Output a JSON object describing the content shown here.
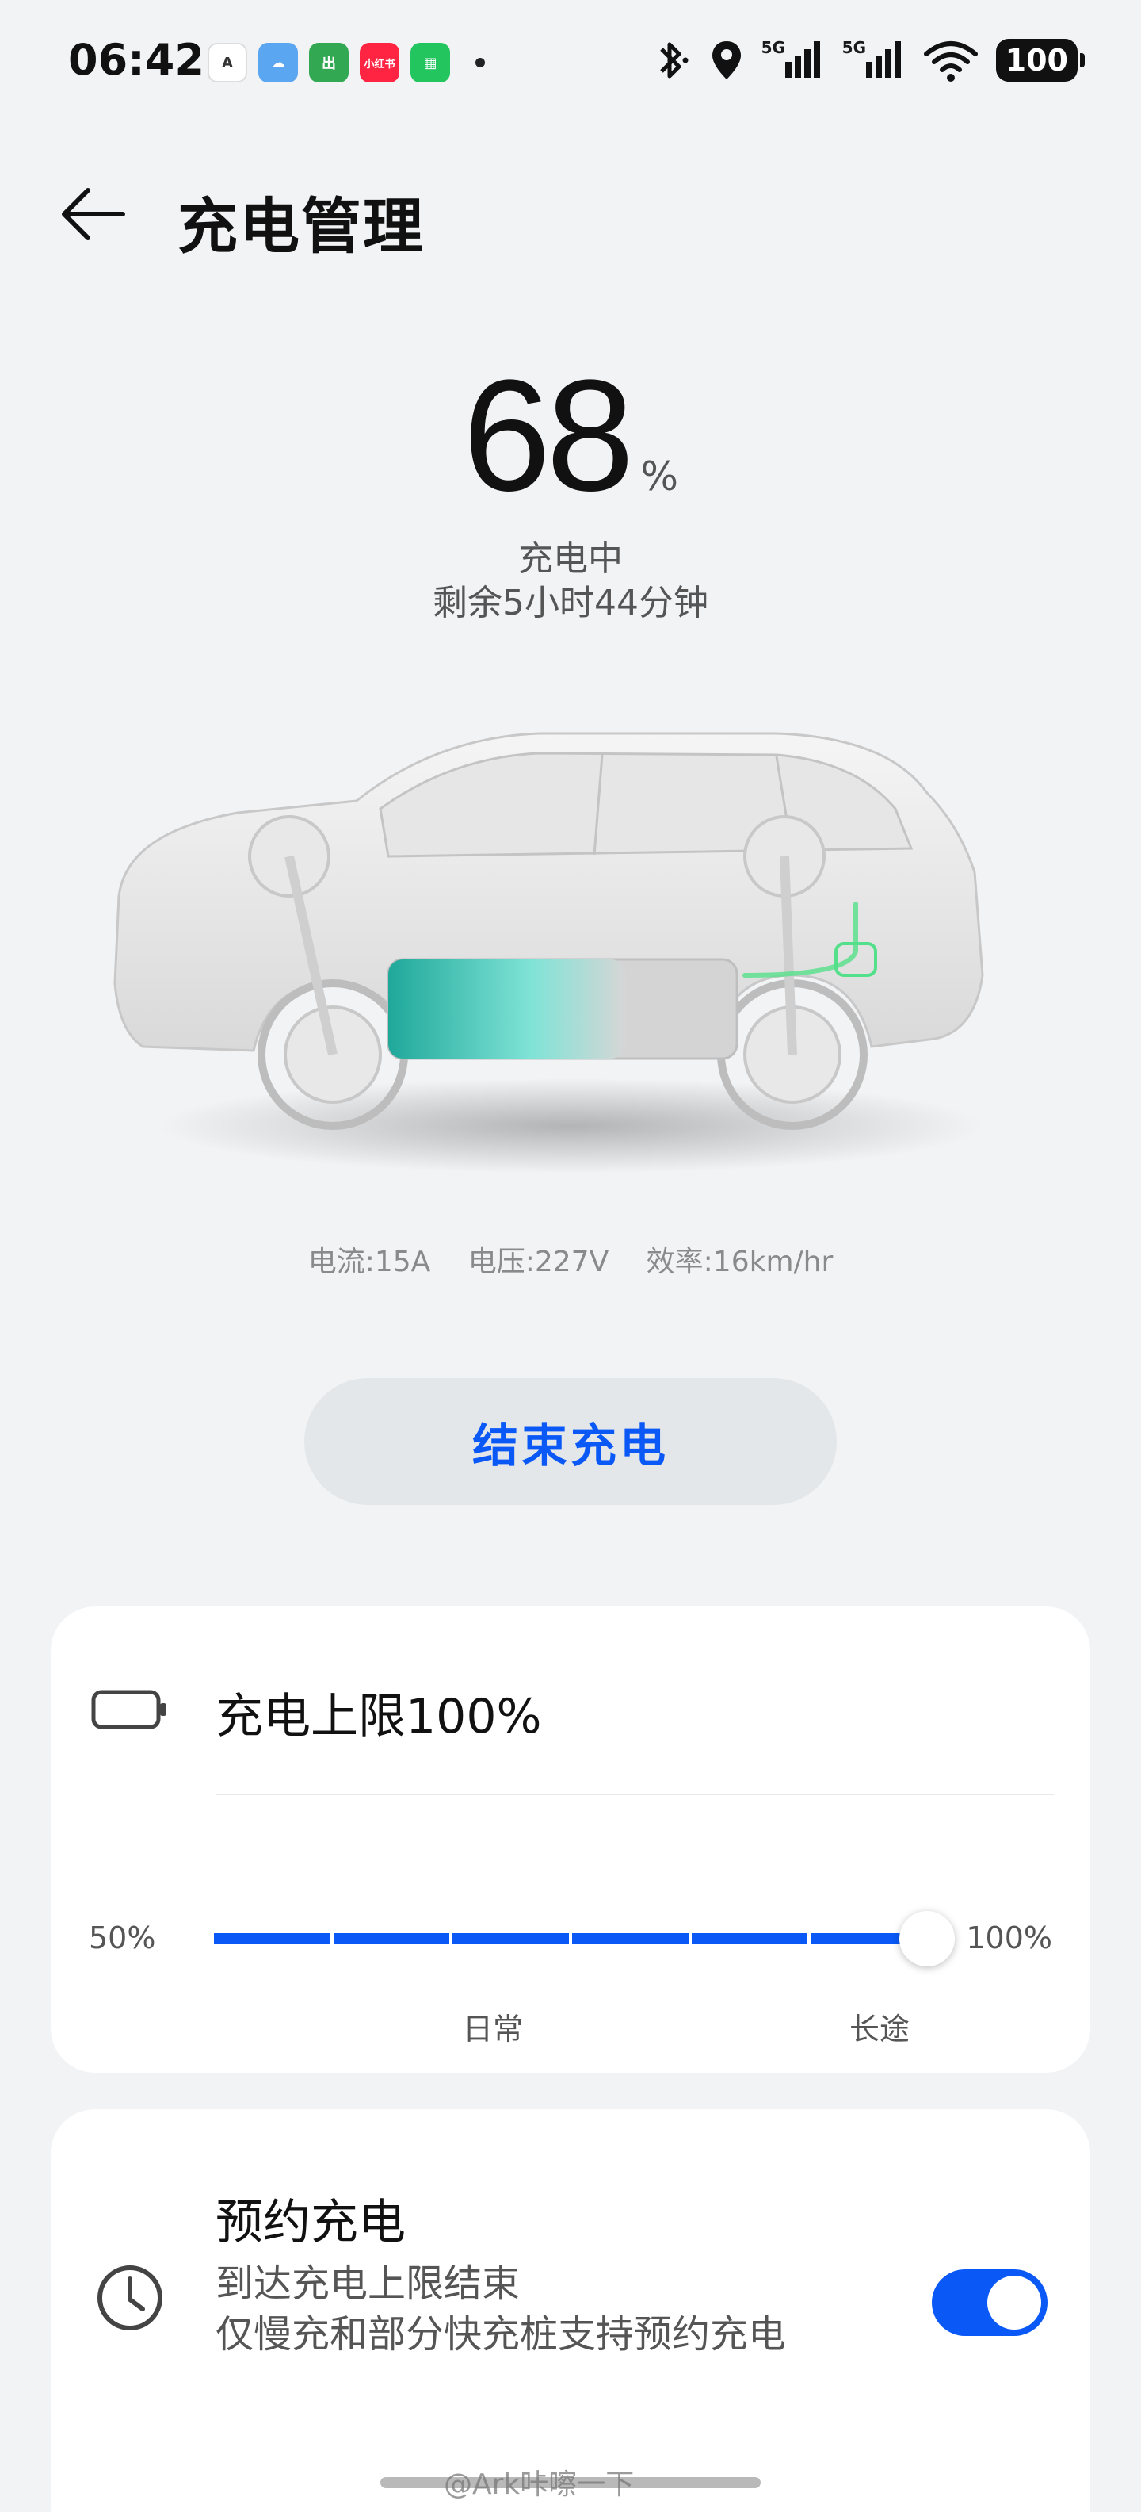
{
  "status_bar": {
    "time": "06:42",
    "app_icons": [
      {
        "name": "app-icon-1",
        "label": "A",
        "color": "#ffffff",
        "text_color": "#333333"
      },
      {
        "name": "weather-icon",
        "label": "☁",
        "color": "#5aa6f0",
        "text_color": "#ffffff"
      },
      {
        "name": "app-icon-3",
        "label": "出",
        "color": "#33a853",
        "text_color": "#ffffff"
      },
      {
        "name": "xiaohongshu-icon",
        "label": "小红书",
        "color": "#ff2442",
        "text_color": "#ffffff"
      },
      {
        "name": "app-icon-5",
        "label": "▦",
        "color": "#22c55e",
        "text_color": "#ffffff"
      }
    ],
    "signal1": "5G",
    "signal2": "5G",
    "battery": "100"
  },
  "header": {
    "title": "充电管理"
  },
  "charge": {
    "soc": "68",
    "unit": "%",
    "state": "充电中",
    "remaining": "剩余5小时44分钟",
    "current": "电流:15A",
    "voltage": "电压:227V",
    "efficiency": "效率:16km/hr",
    "battery_fill_fraction": 0.68
  },
  "stop_button": {
    "label": "结束充电"
  },
  "limit_card": {
    "title": "充电上限100%",
    "min_label": "50%",
    "max_label": "100%",
    "tick_daily": "日常",
    "tick_long": "长途",
    "value_percent": 100
  },
  "schedule_card": {
    "title": "预约充电",
    "subtitle": "到达充电上限结束",
    "note": "仅慢充和部分快充桩支持预约充电",
    "enabled": true
  },
  "watermark": "@Ark咔嚓一下",
  "colors": {
    "accent": "#0a59f7",
    "background": "#f1f3f5",
    "card": "#ffffff"
  }
}
